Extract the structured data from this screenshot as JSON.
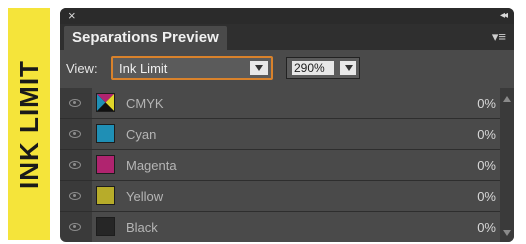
{
  "side_tag": {
    "text": "INK LIMIT",
    "color": "#f5e43a"
  },
  "panel": {
    "close_glyph": "×",
    "collapse_glyph": "◂◂",
    "title": "Separations Preview",
    "menu_glyph": "▾≡",
    "view": {
      "label": "View:",
      "selected": "Ink Limit"
    },
    "zoom": {
      "value": "290%"
    },
    "inks": [
      {
        "name": "CMYK",
        "percent": "0%",
        "swatch": "cmyk"
      },
      {
        "name": "Cyan",
        "percent": "0%",
        "swatch": "#1f8fb5"
      },
      {
        "name": "Magenta",
        "percent": "0%",
        "swatch": "#b0246f"
      },
      {
        "name": "Yellow",
        "percent": "0%",
        "swatch": "#b7ac2a"
      },
      {
        "name": "Black",
        "percent": "0%",
        "swatch": "#262626"
      }
    ],
    "colors": {
      "accent": "#d9822b",
      "panel_bg": "#3a3a3a",
      "row_bg": "#4a4a4a"
    }
  }
}
